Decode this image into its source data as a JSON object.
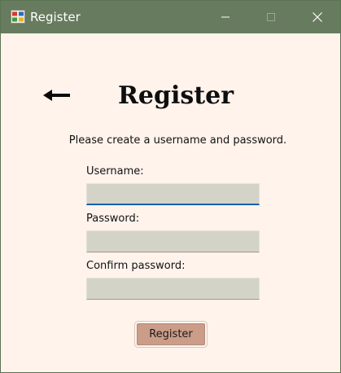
{
  "window": {
    "title": "Register",
    "icon": "app-icon",
    "controls": {
      "minimize_icon": "minimize-icon",
      "maximize_icon": "maximize-icon",
      "close_icon": "close-icon"
    }
  },
  "form": {
    "back_icon": "back-arrow-icon",
    "heading": "Register",
    "instructions": "Please create a username and password.",
    "fields": {
      "username": {
        "label": "Username:",
        "value": ""
      },
      "password": {
        "label": "Password:",
        "value": ""
      },
      "confirm_password": {
        "label": "Confirm password:",
        "value": ""
      }
    },
    "submit_label": "Register"
  },
  "colors": {
    "titlebar": "#677b5e",
    "background": "#fff3ec",
    "field": "#d3d3c8",
    "focus_underline": "#1a5fae",
    "button": "#cb9c88"
  }
}
